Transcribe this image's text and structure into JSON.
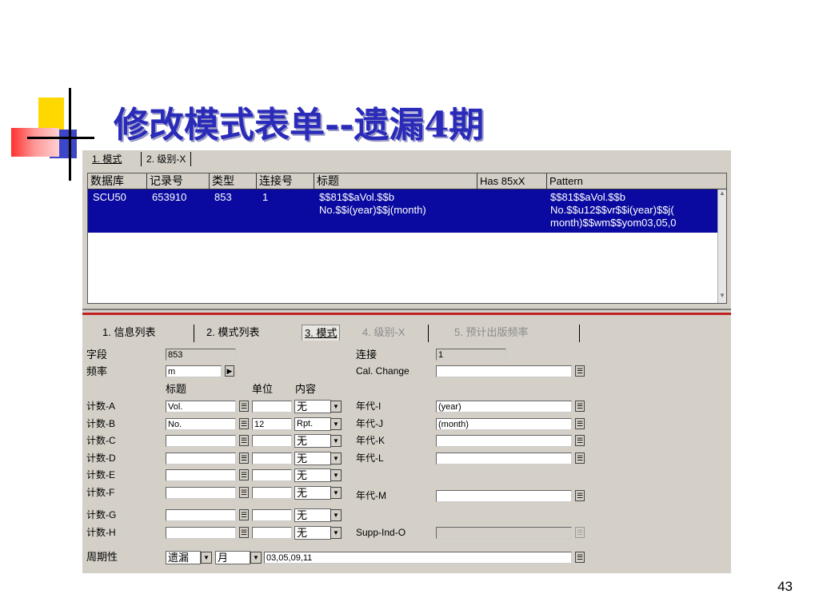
{
  "slide": {
    "title": "修改模式表单--遗漏4期",
    "page_number": "43"
  },
  "top_tabs": [
    "1. 模式",
    "2. 级别-X"
  ],
  "grid": {
    "headers": [
      "数据库",
      "记录号",
      "类型",
      "连接号",
      "标题",
      "Has 85xX",
      "Pattern"
    ],
    "row": {
      "db": "SCU50",
      "record": "653910",
      "type": "853",
      "link": "1",
      "title_l1": "$$81$$aVol.$$b",
      "title_l2": "No.$$i(year)$$j(month)",
      "pattern_l1": "$$81$$aVol.$$b",
      "pattern_l2": "No.$$u12$$vr$$i(year)$$j(",
      "pattern_l3": "month)$$wm$$yom03,05,0"
    }
  },
  "bottom_tabs": [
    "1. 信息列表",
    "2. 模式列表",
    "3. 模式",
    "4. 级别-X",
    "5. 预计出版频率"
  ],
  "form": {
    "field_label": "字段",
    "field_value": "853",
    "freq_label": "频率",
    "freq_value": "m",
    "link_label": "连接",
    "link_value": "1",
    "cal_label": "Cal. Change",
    "cal_value": "",
    "col_title": "标题",
    "col_unit": "单位",
    "col_content": "内容",
    "counts": [
      {
        "label": "计数-A",
        "title": "Vol.",
        "unit": "",
        "content": "无"
      },
      {
        "label": "计数-B",
        "title": " No.",
        "unit": "12",
        "content": "Rpt."
      },
      {
        "label": "计数-C",
        "title": "",
        "unit": "",
        "content": "无"
      },
      {
        "label": "计数-D",
        "title": "",
        "unit": "",
        "content": "无"
      },
      {
        "label": "计数-E",
        "title": "",
        "unit": "",
        "content": "无"
      },
      {
        "label": "计数-F",
        "title": "",
        "unit": "",
        "content": "无"
      },
      {
        "label": "计数-G",
        "title": "",
        "unit": "",
        "content": "无"
      },
      {
        "label": "计数-H",
        "title": "",
        "unit": "",
        "content": "无"
      }
    ],
    "years": [
      {
        "label": "年代-I",
        "value": "(year)"
      },
      {
        "label": "年代-J",
        "value": "(month)"
      },
      {
        "label": "年代-K",
        "value": ""
      },
      {
        "label": "年代-L",
        "value": ""
      },
      {
        "label": "年代-M",
        "value": ""
      }
    ],
    "supp_label": "Supp-Ind-O",
    "supp_value": "",
    "period_label": "周期性",
    "period_type": "遗漏",
    "period_unit": "月",
    "period_value": "03,05,09,11"
  },
  "colors": {
    "title": "#2a2bb8",
    "selection": "#0a0aa0",
    "panel": "#d4d0c8",
    "accent_red": "#c02020"
  },
  "icons": {
    "edit_button": "edit-list-icon",
    "arrow": "arrow-right-icon",
    "dropdown": "chevron-down-icon"
  }
}
